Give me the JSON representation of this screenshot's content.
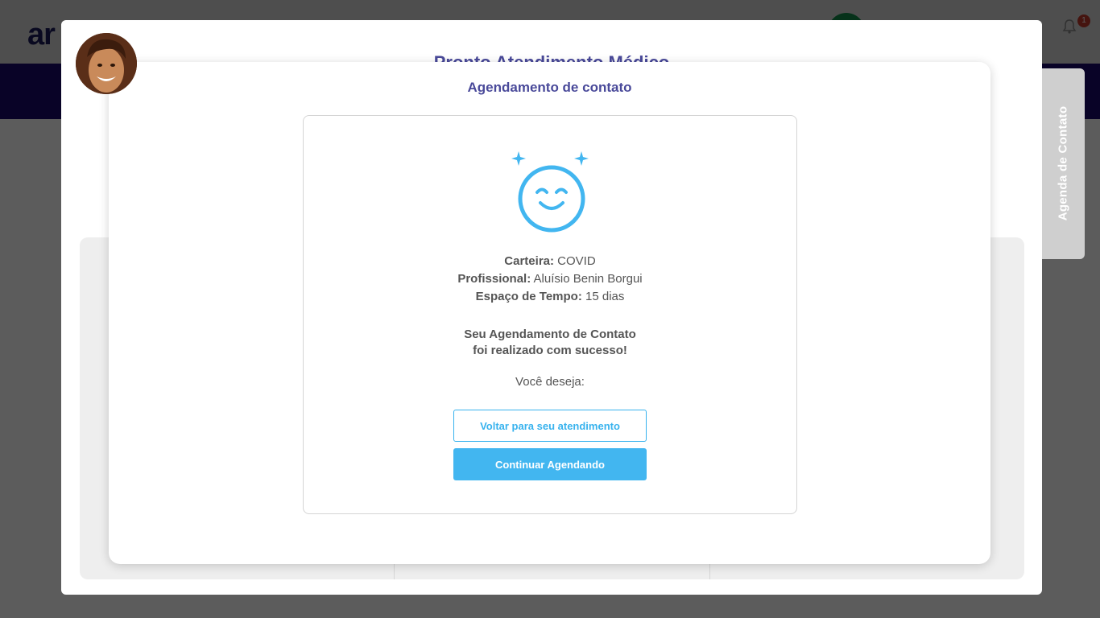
{
  "background": {
    "logo_text": "ar",
    "notification_count": "1"
  },
  "modal": {
    "title": "Pronto Atendimento Médico",
    "side_tab_label": "Agenda de Contato"
  },
  "dialog": {
    "title": "Agendamento de contato",
    "fields": [
      {
        "label": "Carteira:",
        "value": "COVID"
      },
      {
        "label": "Profissional:",
        "value": "Aluísio Benin Borgui"
      },
      {
        "label": "Espaço de Tempo:",
        "value": "15 dias"
      }
    ],
    "success_line1": "Seu Agendamento de Contato",
    "success_line2": "foi realizado com sucesso!",
    "question": "Você deseja:",
    "back_button": "Voltar para seu atendimento",
    "continue_button": "Continuar Agendando"
  },
  "colors": {
    "accent": "#42b6f0",
    "title": "#4a4a9a",
    "brand_nav": "#1b0a6e"
  },
  "icons": [
    "bell-icon",
    "happy-face-icon",
    "sparkle-icon"
  ]
}
